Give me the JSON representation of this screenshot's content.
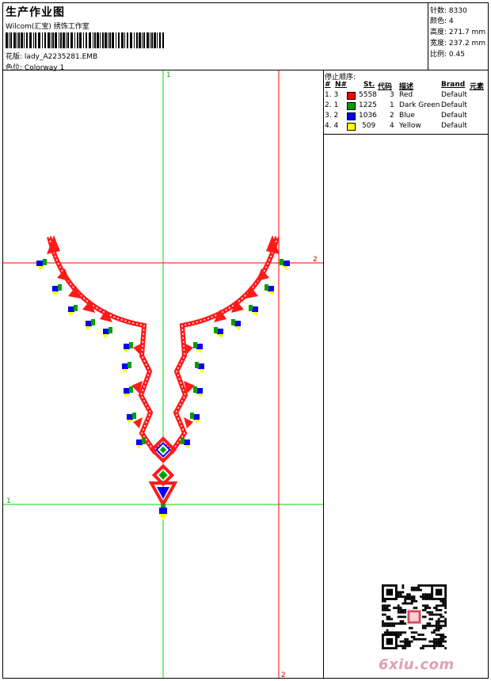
{
  "header": {
    "title": "生产作业图",
    "subtitle": "Wilcom(汇宝) 绣饰工作室",
    "file_label": "花版:",
    "file_name": "lady_A2235281.EMB",
    "colorway_label": "色位:",
    "colorway": "Colorway 1"
  },
  "stats": [
    {
      "label": "针数:",
      "value": "8330"
    },
    {
      "label": "颜色:",
      "value": "4"
    },
    {
      "label": "高度:",
      "value": "271.7 mm"
    },
    {
      "label": "宽度:",
      "value": "237.2 mm"
    },
    {
      "label": "比例:",
      "value": "0.45"
    }
  ],
  "sequence": {
    "title": "停止顺序:",
    "headers": [
      "#",
      "N#",
      "St.",
      "代码",
      "描述",
      "Brand",
      "元素"
    ],
    "rows": [
      {
        "num": "1. 3",
        "color": "#ff0000",
        "stitches": "5558",
        "code": "3",
        "desc": "Red",
        "brand": "Default"
      },
      {
        "num": "2. 1",
        "color": "#00a000",
        "stitches": "1225",
        "code": "1",
        "desc": "Dark Green",
        "brand": "Default"
      },
      {
        "num": "3. 2",
        "color": "#0000ff",
        "stitches": "1036",
        "code": "2",
        "desc": "Blue",
        "brand": "Default"
      },
      {
        "num": "4. 4",
        "color": "#ffff00",
        "stitches": "509",
        "code": "4",
        "desc": "Yellow",
        "brand": "Default"
      }
    ]
  },
  "guides": {
    "green_top": "1",
    "green_left": "1",
    "red_right": "2",
    "red_bottom": "2"
  },
  "watermark": "6xiu.com"
}
